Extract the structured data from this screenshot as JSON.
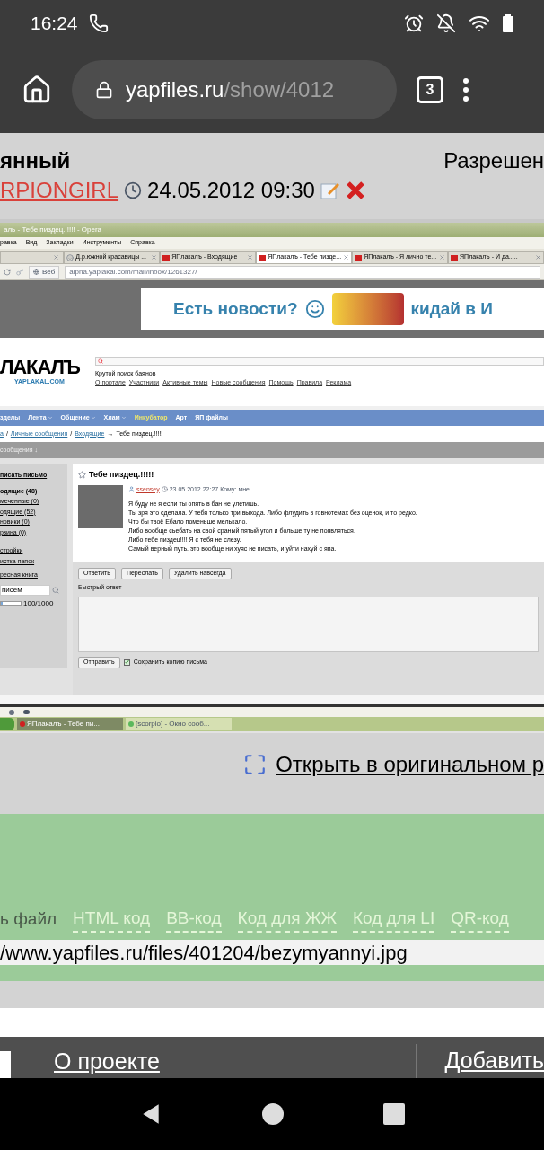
{
  "status_bar": {
    "time": "16:24"
  },
  "browser": {
    "url_host": "yapfiles.ru",
    "url_path": "/show/4012",
    "tab_count": "3"
  },
  "post": {
    "title": "янный",
    "permission": "Разрешен",
    "author": "RPIONGIRL",
    "date": "24.05.2012 09:30"
  },
  "screenshot": {
    "window_title": "аль - Тебе пиздец.!!!!! - Opera",
    "menu": [
      "равка",
      "Вид",
      "Закладки",
      "Инструменты",
      "Справка"
    ],
    "tabs": [
      {
        "label": "Д.р.южной красавицы ...",
        "kind": "page",
        "selected": false
      },
      {
        "label": "ЯПлакалъ - Входящие",
        "kind": "site",
        "selected": false
      },
      {
        "label": "ЯПлакалъ - Тебе пизде...",
        "kind": "site",
        "selected": true
      },
      {
        "label": "ЯПлакалъ - Я лично те...",
        "kind": "site",
        "selected": false
      },
      {
        "label": "ЯПлакалъ - И да.....",
        "kind": "site",
        "selected": false
      }
    ],
    "address": {
      "button": "Веб",
      "url": "alpha.yaplakal.com/mail/inbox/1261327/"
    },
    "banner": {
      "left": "Есть новости?",
      "right": "кидай в И"
    },
    "site": {
      "logo": "ЛАКАЛЪ",
      "logo_sub": "YAPLAKAL.COM",
      "search_hint": "Крутой поиск баянов",
      "links": [
        "О портале",
        "Участники",
        "Активные темы",
        "Новые сообщения",
        "Помощь",
        "Правила",
        "Реклама"
      ]
    },
    "nav": [
      {
        "label": "зделы",
        "highlight": false,
        "dropdown": false
      },
      {
        "label": "Лента",
        "highlight": false,
        "dropdown": true
      },
      {
        "label": "Общение",
        "highlight": false,
        "dropdown": true
      },
      {
        "label": "Хлам",
        "highlight": false,
        "dropdown": true
      },
      {
        "label": "Инкубатор",
        "highlight": true,
        "dropdown": false
      },
      {
        "label": "Арт",
        "highlight": false,
        "dropdown": false
      },
      {
        "label": "ЯП файлы",
        "highlight": false,
        "dropdown": false
      }
    ],
    "breadcrumb": [
      {
        "text": "а",
        "kind": "link"
      },
      {
        "text": "/",
        "kind": "sep"
      },
      {
        "text": "Личные сообщения",
        "kind": "link"
      },
      {
        "text": "/",
        "kind": "sep"
      },
      {
        "text": "Входящие",
        "kind": "link"
      },
      {
        "text": "→",
        "kind": "sep"
      },
      {
        "text": "Тебе пиздец.!!!!!",
        "kind": "text"
      }
    ],
    "section_bar": "сообщения ↓",
    "sidebar": {
      "compose": "писать письмо",
      "folders": [
        {
          "label": "одящие (48)",
          "selected": true
        },
        {
          "label": "меченные (0)",
          "selected": false
        },
        {
          "label": "одящие (52)",
          "selected": false
        },
        {
          "label": "новики (0)",
          "selected": false
        },
        {
          "label": "рзина (0)",
          "selected": false
        }
      ],
      "links": [
        "стройки",
        "истка папок",
        "ресная книга"
      ],
      "search_value": "писем",
      "quota": {
        "level": 0.1,
        "reading": "100/1000"
      }
    },
    "message": {
      "subject": "Тебе пиздец.!!!!!",
      "author": "ssensey",
      "date": "23.05.2012 22:27 Кому: мне",
      "lines": [
        "Я буду не я если ты опять в бан не улетишь.",
        "Ты зря это сделала. У тебя только три выхода. Либо флудить в говнотемах без оценок, и то редко.",
        "Что бы твоё Ебало поменьше мелькало.",
        "Либо вообще сьебать на свой сраный пятый угол и больше ту не появляться.",
        "Либо тебе пиздец!!!! Я с тебя не слезу.",
        "Самый верный путь. это вообще ни хуяс не писать, и уйти нахуй с япа."
      ],
      "actions": [
        "Ответить",
        "Переслать",
        "Удалить навсегда"
      ],
      "quick_reply_label": "Быстрый ответ",
      "send": "Отправить",
      "save_copy": {
        "label": "Сохранить копию письма",
        "checked": true
      }
    },
    "taskbar": [
      {
        "label": "ЯПлакалъ - Тебе пи...",
        "selected": true
      },
      {
        "label": "[scorpio] - Окно сооб...",
        "selected": false
      }
    ]
  },
  "open_original": "Открыть в оригинальном р",
  "share": {
    "label": "ь файл",
    "links": [
      "HTML код",
      "BB-код",
      "Код для ЖЖ",
      "Код для LI",
      "QR-код"
    ],
    "url": "/www.yapfiles.ru/files/401204/bezymyannyi.jpg"
  },
  "footer": {
    "links": [
      "О проекте",
      "Добавить"
    ]
  }
}
